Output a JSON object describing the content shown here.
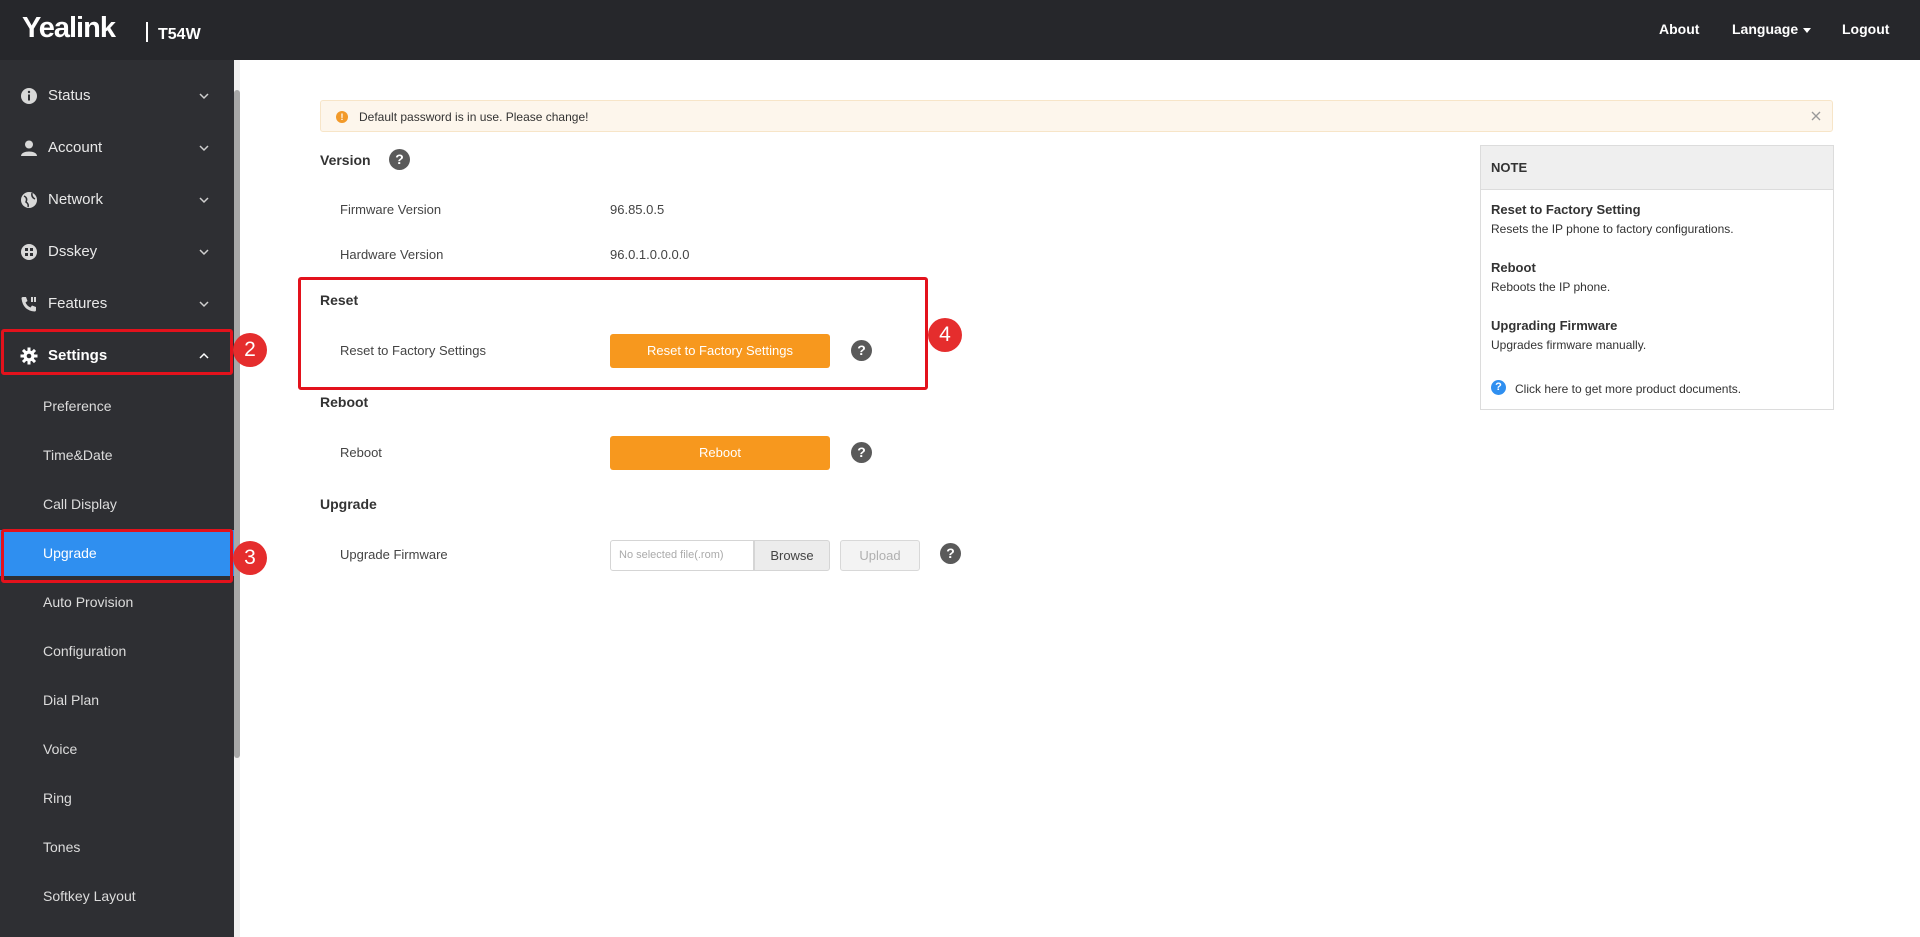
{
  "header": {
    "brand": "Yealink",
    "model": "T54W",
    "nav": {
      "about": "About",
      "language": "Language",
      "logout": "Logout"
    }
  },
  "sidebar": {
    "items": [
      {
        "label": "Status",
        "icon": "info-icon"
      },
      {
        "label": "Account",
        "icon": "user-icon"
      },
      {
        "label": "Network",
        "icon": "globe-icon"
      },
      {
        "label": "Dsskey",
        "icon": "grid-icon"
      },
      {
        "label": "Features",
        "icon": "phone-icon"
      },
      {
        "label": "Settings",
        "icon": "gear-icon",
        "expanded": true
      }
    ],
    "subitems": [
      "Preference",
      "Time&Date",
      "Call Display",
      "Upgrade",
      "Auto Provision",
      "Configuration",
      "Dial Plan",
      "Voice",
      "Ring",
      "Tones",
      "Softkey Layout"
    ],
    "selected": "Upgrade"
  },
  "markers": [
    "2",
    "3",
    "4"
  ],
  "alert": {
    "text": "Default password is in use. Please change!"
  },
  "version": {
    "title": "Version",
    "firmware_label": "Firmware Version",
    "firmware_value": "96.85.0.5",
    "hardware_label": "Hardware Version",
    "hardware_value": "96.0.1.0.0.0.0"
  },
  "reset": {
    "title": "Reset",
    "label": "Reset to Factory Settings",
    "button": "Reset to Factory Settings"
  },
  "reboot": {
    "title": "Reboot",
    "label": "Reboot",
    "button": "Reboot"
  },
  "upgrade": {
    "title": "Upgrade",
    "label": "Upgrade Firmware",
    "file_placeholder": "No selected file(.rom)",
    "browse": "Browse",
    "upload": "Upload"
  },
  "note": {
    "title": "NOTE",
    "sections": [
      {
        "heading": "Reset to Factory Setting",
        "text": "Resets the IP phone to factory configurations."
      },
      {
        "heading": "Reboot",
        "text": "Reboots the IP phone."
      },
      {
        "heading": "Upgrading Firmware",
        "text": "Upgrades firmware manually."
      }
    ],
    "link": "Click here to get more product documents."
  },
  "colors": {
    "accent_orange": "#f7981e",
    "selected_blue": "#2f8ff0",
    "sidebar_bg": "#2e2f33",
    "topbar_bg": "#26272b",
    "annotation_red": "#e3121c"
  }
}
